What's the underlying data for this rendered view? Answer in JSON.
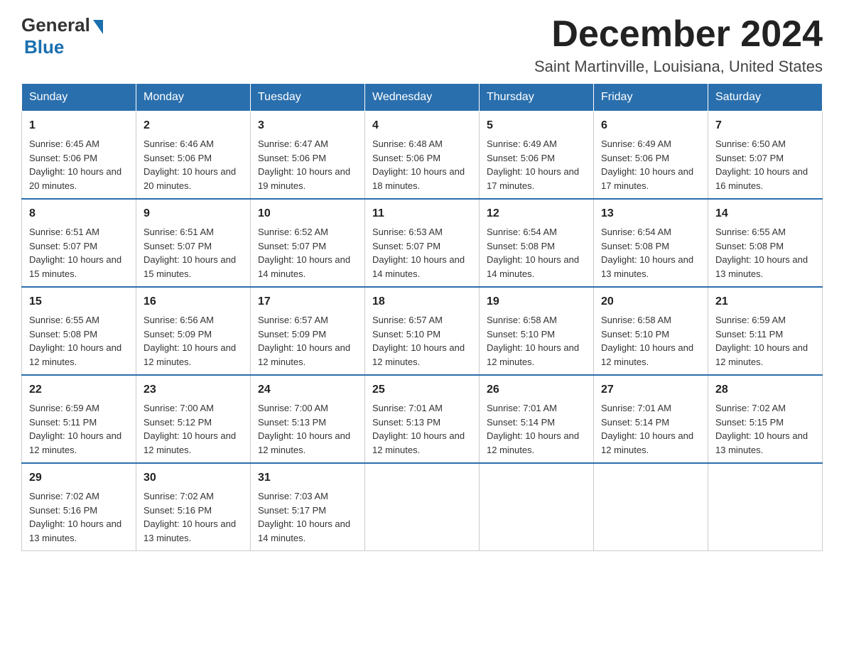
{
  "logo": {
    "general": "General",
    "blue": "Blue"
  },
  "title": "December 2024",
  "location": "Saint Martinville, Louisiana, United States",
  "days_of_week": [
    "Sunday",
    "Monday",
    "Tuesday",
    "Wednesday",
    "Thursday",
    "Friday",
    "Saturday"
  ],
  "weeks": [
    [
      {
        "day": "1",
        "sunrise": "6:45 AM",
        "sunset": "5:06 PM",
        "daylight": "10 hours and 20 minutes."
      },
      {
        "day": "2",
        "sunrise": "6:46 AM",
        "sunset": "5:06 PM",
        "daylight": "10 hours and 20 minutes."
      },
      {
        "day": "3",
        "sunrise": "6:47 AM",
        "sunset": "5:06 PM",
        "daylight": "10 hours and 19 minutes."
      },
      {
        "day": "4",
        "sunrise": "6:48 AM",
        "sunset": "5:06 PM",
        "daylight": "10 hours and 18 minutes."
      },
      {
        "day": "5",
        "sunrise": "6:49 AM",
        "sunset": "5:06 PM",
        "daylight": "10 hours and 17 minutes."
      },
      {
        "day": "6",
        "sunrise": "6:49 AM",
        "sunset": "5:06 PM",
        "daylight": "10 hours and 17 minutes."
      },
      {
        "day": "7",
        "sunrise": "6:50 AM",
        "sunset": "5:07 PM",
        "daylight": "10 hours and 16 minutes."
      }
    ],
    [
      {
        "day": "8",
        "sunrise": "6:51 AM",
        "sunset": "5:07 PM",
        "daylight": "10 hours and 15 minutes."
      },
      {
        "day": "9",
        "sunrise": "6:51 AM",
        "sunset": "5:07 PM",
        "daylight": "10 hours and 15 minutes."
      },
      {
        "day": "10",
        "sunrise": "6:52 AM",
        "sunset": "5:07 PM",
        "daylight": "10 hours and 14 minutes."
      },
      {
        "day": "11",
        "sunrise": "6:53 AM",
        "sunset": "5:07 PM",
        "daylight": "10 hours and 14 minutes."
      },
      {
        "day": "12",
        "sunrise": "6:54 AM",
        "sunset": "5:08 PM",
        "daylight": "10 hours and 14 minutes."
      },
      {
        "day": "13",
        "sunrise": "6:54 AM",
        "sunset": "5:08 PM",
        "daylight": "10 hours and 13 minutes."
      },
      {
        "day": "14",
        "sunrise": "6:55 AM",
        "sunset": "5:08 PM",
        "daylight": "10 hours and 13 minutes."
      }
    ],
    [
      {
        "day": "15",
        "sunrise": "6:55 AM",
        "sunset": "5:08 PM",
        "daylight": "10 hours and 12 minutes."
      },
      {
        "day": "16",
        "sunrise": "6:56 AM",
        "sunset": "5:09 PM",
        "daylight": "10 hours and 12 minutes."
      },
      {
        "day": "17",
        "sunrise": "6:57 AM",
        "sunset": "5:09 PM",
        "daylight": "10 hours and 12 minutes."
      },
      {
        "day": "18",
        "sunrise": "6:57 AM",
        "sunset": "5:10 PM",
        "daylight": "10 hours and 12 minutes."
      },
      {
        "day": "19",
        "sunrise": "6:58 AM",
        "sunset": "5:10 PM",
        "daylight": "10 hours and 12 minutes."
      },
      {
        "day": "20",
        "sunrise": "6:58 AM",
        "sunset": "5:10 PM",
        "daylight": "10 hours and 12 minutes."
      },
      {
        "day": "21",
        "sunrise": "6:59 AM",
        "sunset": "5:11 PM",
        "daylight": "10 hours and 12 minutes."
      }
    ],
    [
      {
        "day": "22",
        "sunrise": "6:59 AM",
        "sunset": "5:11 PM",
        "daylight": "10 hours and 12 minutes."
      },
      {
        "day": "23",
        "sunrise": "7:00 AM",
        "sunset": "5:12 PM",
        "daylight": "10 hours and 12 minutes."
      },
      {
        "day": "24",
        "sunrise": "7:00 AM",
        "sunset": "5:13 PM",
        "daylight": "10 hours and 12 minutes."
      },
      {
        "day": "25",
        "sunrise": "7:01 AM",
        "sunset": "5:13 PM",
        "daylight": "10 hours and 12 minutes."
      },
      {
        "day": "26",
        "sunrise": "7:01 AM",
        "sunset": "5:14 PM",
        "daylight": "10 hours and 12 minutes."
      },
      {
        "day": "27",
        "sunrise": "7:01 AM",
        "sunset": "5:14 PM",
        "daylight": "10 hours and 12 minutes."
      },
      {
        "day": "28",
        "sunrise": "7:02 AM",
        "sunset": "5:15 PM",
        "daylight": "10 hours and 13 minutes."
      }
    ],
    [
      {
        "day": "29",
        "sunrise": "7:02 AM",
        "sunset": "5:16 PM",
        "daylight": "10 hours and 13 minutes."
      },
      {
        "day": "30",
        "sunrise": "7:02 AM",
        "sunset": "5:16 PM",
        "daylight": "10 hours and 13 minutes."
      },
      {
        "day": "31",
        "sunrise": "7:03 AM",
        "sunset": "5:17 PM",
        "daylight": "10 hours and 14 minutes."
      },
      null,
      null,
      null,
      null
    ]
  ]
}
